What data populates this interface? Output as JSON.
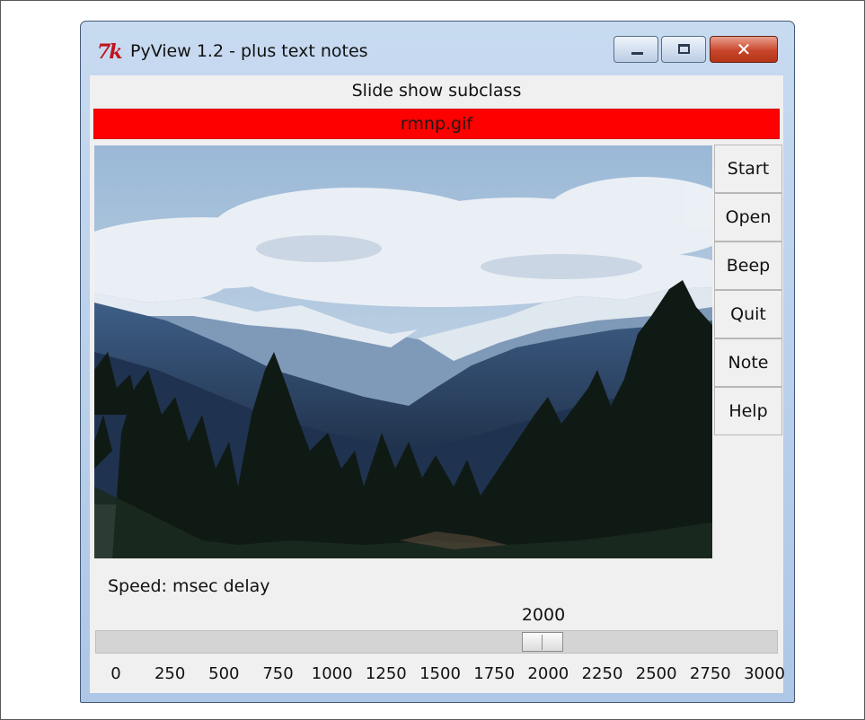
{
  "window": {
    "title": "PyView 1.2 - plus text notes",
    "logo_text": "7k"
  },
  "header": {
    "subclass_label": "Slide show subclass",
    "image_name": "rmnp.gif"
  },
  "buttons": [
    "Start",
    "Open",
    "Beep",
    "Quit",
    "Note",
    "Help"
  ],
  "speed": {
    "label": "Speed: msec delay",
    "value": "2000",
    "min": 0,
    "max": 3000,
    "ticks": [
      "0",
      "250",
      "500",
      "750",
      "1000",
      "1250",
      "1500",
      "1750",
      "2000",
      "2250",
      "2500",
      "2750",
      "3000"
    ]
  },
  "colors": {
    "name_bar": "#ff0000",
    "window_frame": "#aec7e6",
    "close_button": "#c9462c"
  },
  "icons": {
    "minimize": "minimize-icon",
    "maximize": "maximize-icon",
    "close": "close-icon"
  }
}
